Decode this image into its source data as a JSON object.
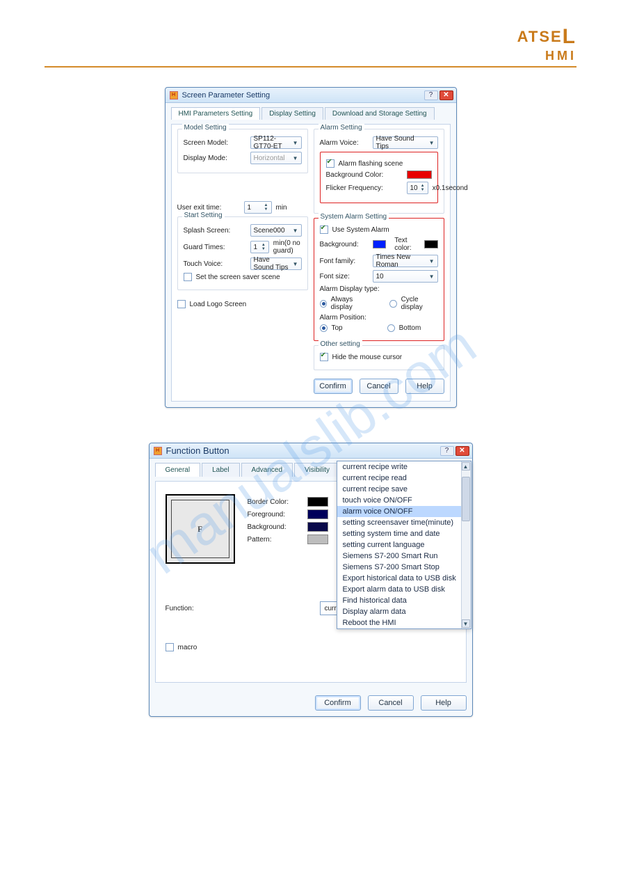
{
  "brand": {
    "line1": "ATSE",
    "line1_big": "L",
    "line2": "HMI"
  },
  "win1": {
    "title": "Screen Parameter Setting",
    "tabs": [
      "HMI Parameters Setting",
      "Display Setting",
      "Download and Storage Setting"
    ],
    "active_tab": 0,
    "model_setting": {
      "legend": "Model Setting",
      "screen_model_label": "Screen Model:",
      "screen_model_value": "SP112-GT70-ET",
      "display_mode_label": "Display Mode:",
      "display_mode_value": "Horizontal"
    },
    "user_exit": {
      "label": "User exit time:",
      "value": "1",
      "unit": "min"
    },
    "start_setting": {
      "legend": "Start Setting",
      "splash_label": "Splash Screen:",
      "splash_value": "Scene000",
      "guard_label": "Guard Times:",
      "guard_value": "1",
      "guard_unit": "min(0 no guard)",
      "touch_label": "Touch Voice:",
      "touch_value": "Have Sound Tips",
      "saver_label": "Set the screen saver scene"
    },
    "load_logo": "Load Logo Screen",
    "alarm_setting": {
      "legend": "Alarm Setting",
      "voice_label": "Alarm Voice:",
      "voice_value": "Have Sound Tips",
      "flashing_label": "Alarm flashing scene",
      "bg_label": "Background Color:",
      "bg_hex": "#e80000",
      "flicker_label": "Flicker Frequency:",
      "flicker_value": "10",
      "flicker_unit": "x0.1second"
    },
    "system_alarm": {
      "legend": "System Alarm Setting",
      "use_label": "Use System Alarm",
      "bg_label": "Background:",
      "bg_hex": "#0020ff",
      "text_label": "Text color:",
      "text_hex": "#000000",
      "font_family_label": "Font family:",
      "font_family_value": "Times New Roman",
      "font_size_label": "Font size:",
      "font_size_value": "10",
      "display_type_label": "Alarm Display type:",
      "display_type_opts": [
        "Always display",
        "Cycle display"
      ],
      "position_label": "Alarm Position:",
      "position_opts": [
        "Top",
        "Bottom"
      ]
    },
    "other_setting": {
      "legend": "Other setting",
      "hide_label": "Hide the mouse cursor"
    },
    "buttons": [
      "Confirm",
      "Cancel",
      "Help"
    ]
  },
  "win2": {
    "title": "Function Button",
    "tabs": [
      "General",
      "Label",
      "Advanced",
      "Visibility"
    ],
    "active_tab": 0,
    "preview_letter": "F",
    "color_labels": {
      "border": "Border Color:",
      "fore": "Foreground:",
      "back": "Background:",
      "pattern": "Pattern:"
    },
    "color_values": {
      "border": "#000000",
      "fore": "#00005a",
      "back": "#0a0a4a",
      "pattern": "#bdbdbd"
    },
    "function_label": "Function:",
    "function_value": "current recipe write",
    "macro_label": "macro",
    "dropdown_items": [
      "current recipe write",
      "current recipe read",
      "current recipe save",
      "touch voice ON/OFF",
      "alarm voice ON/OFF",
      "setting screensaver time(minute)",
      "setting system time and date",
      "setting current language",
      "Siemens S7-200 Smart Run",
      "Siemens S7-200 Smart Stop",
      "Export historical data to USB disk",
      "Export alarm data to USB disk",
      "Find historical data",
      "Display alarm data",
      "Reboot the HMI"
    ],
    "dropdown_highlight": 4,
    "buttons": [
      "Confirm",
      "Cancel",
      "Help"
    ]
  },
  "watermark": "manualslib.com"
}
